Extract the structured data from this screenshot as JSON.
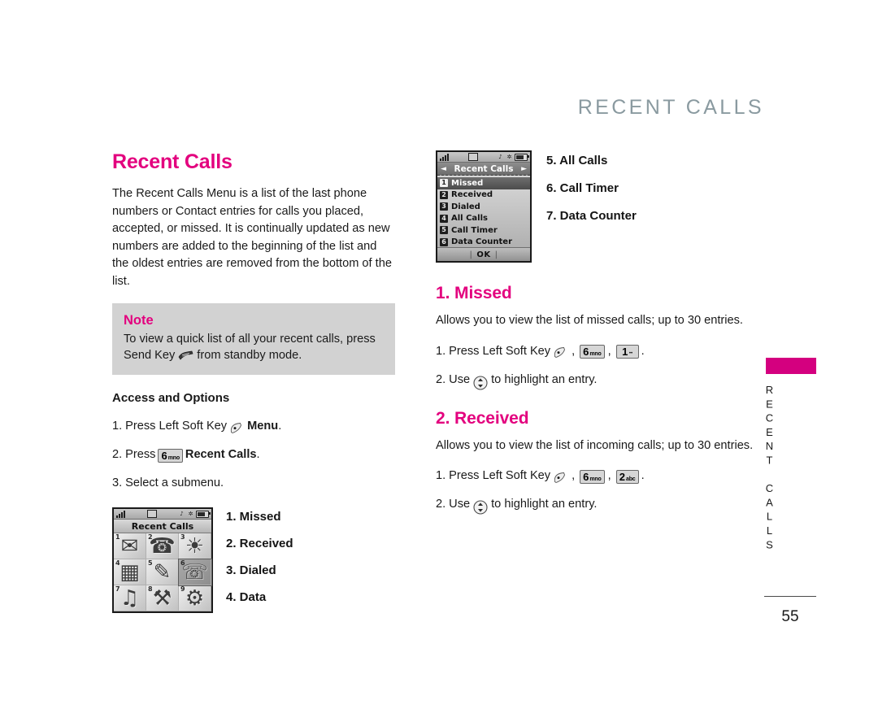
{
  "header": {
    "title": "RECENT CALLS"
  },
  "tab": {
    "label": "RECENT CALLS"
  },
  "footer": {
    "page_number": "55"
  },
  "colors": {
    "accent_magenta": "#E3007E",
    "header_gray": "#8A9AA0",
    "note_background": "#D2D2D2"
  },
  "left_column": {
    "heading": "Recent Calls",
    "intro": "The Recent Calls Menu is a list of the last phone numbers or Contact entries for calls you placed, accepted, or missed. It is continually updated as new numbers are added to the beginning of the list and the oldest entries are removed from the bottom of the list.",
    "note": {
      "title": "Note",
      "text_before_icon": "To view a quick list of all your recent calls, press Send Key",
      "icon": "send-key-icon",
      "text_after_icon": "from standby mode."
    },
    "access_heading": "Access and Options",
    "steps": [
      {
        "num": "1.",
        "text_before": "Press Left Soft Key",
        "icon": "left-soft-key-icon",
        "bold_after": "Menu",
        "period": "."
      },
      {
        "num": "2.",
        "text_before": "Press",
        "key": {
          "big": "6",
          "small": "mno"
        },
        "bold_after": "Recent Calls",
        "period": "."
      },
      {
        "num": "3.",
        "text_before": "Select a submenu.",
        "icon": "",
        "bold_after": "",
        "period": ""
      }
    ],
    "grid_screenshot": {
      "title": "Recent Calls",
      "cells": [
        {
          "num": "1",
          "glyph": "✉",
          "selected": false
        },
        {
          "num": "2",
          "glyph": "☎",
          "selected": false
        },
        {
          "num": "3",
          "glyph": "ἱ0",
          "selected": false
        },
        {
          "num": "4",
          "glyph": "☲",
          "selected": false
        },
        {
          "num": "5",
          "glyph": "✎",
          "selected": false
        },
        {
          "num": "6",
          "glyph": "☏",
          "selected": true
        },
        {
          "num": "7",
          "glyph": "♫",
          "selected": false
        },
        {
          "num": "8",
          "glyph": "⚒",
          "selected": false
        },
        {
          "num": "9",
          "glyph": "⚙",
          "selected": false
        }
      ]
    },
    "submenu_items": [
      "1. Missed",
      "2. Received",
      "3. Dialed",
      "4. Data"
    ]
  },
  "right_column": {
    "list_screenshot": {
      "title": "Recent Calls",
      "left_arrow": "◄",
      "right_arrow": "►",
      "rows": [
        {
          "idx": "1",
          "label": "Missed",
          "selected": true
        },
        {
          "idx": "2",
          "label": "Received",
          "selected": false
        },
        {
          "idx": "3",
          "label": "Dialed",
          "selected": false
        },
        {
          "idx": "4",
          "label": "All Calls",
          "selected": false
        },
        {
          "idx": "5",
          "label": "Call Timer",
          "selected": false
        },
        {
          "idx": "6",
          "label": "Data Counter",
          "selected": false
        }
      ],
      "soft_key_label": "OK"
    },
    "continued_items": [
      "5. All Calls",
      "6. Call Timer",
      "7. Data Counter"
    ],
    "sections": [
      {
        "heading": "1. Missed",
        "body": "Allows you to view the list of missed calls; up to 30 entries.",
        "steps": [
          {
            "num": "1.",
            "text_before": "Press Left Soft Key",
            "icon": "left-soft-key-icon",
            "comma1": ",",
            "key1": {
              "big": "6",
              "small": "mno"
            },
            "comma2": ",",
            "key2": {
              "big": "1",
              "small": "••"
            },
            "period": "."
          },
          {
            "num": "2.",
            "text_before": "Use",
            "icon": "nav-key-icon",
            "text_after": "to highlight an entry."
          }
        ]
      },
      {
        "heading": "2. Received",
        "body": "Allows you to view the list of incoming calls; up to 30 entries.",
        "steps": [
          {
            "num": "1.",
            "text_before": "Press Left Soft Key",
            "icon": "left-soft-key-icon",
            "comma1": ",",
            "key1": {
              "big": "6",
              "small": "mno"
            },
            "comma2": ",",
            "key2": {
              "big": "2",
              "small": "abc"
            },
            "period": "."
          },
          {
            "num": "2.",
            "text_before": "Use",
            "icon": "nav-key-icon",
            "text_after": "to highlight an entry."
          }
        ]
      }
    ]
  }
}
